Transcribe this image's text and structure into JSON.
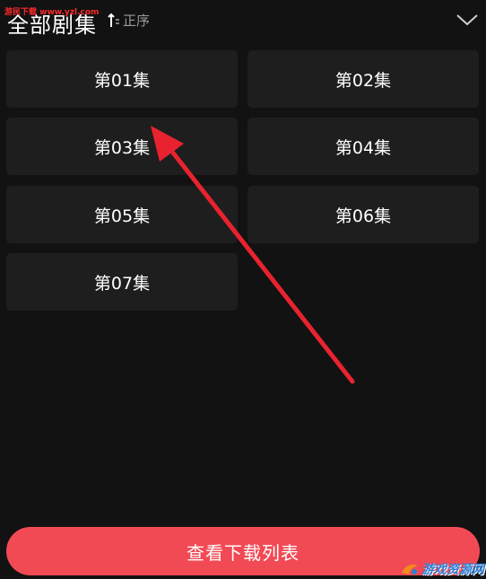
{
  "watermark_top": "游民下载 www.yzl.com",
  "header": {
    "title": "全部剧集",
    "sort_label": "正序"
  },
  "episodes": [
    {
      "label": "第01集"
    },
    {
      "label": "第02集"
    },
    {
      "label": "第03集"
    },
    {
      "label": "第04集"
    },
    {
      "label": "第05集"
    },
    {
      "label": "第06集"
    },
    {
      "label": "第07集"
    }
  ],
  "download_button": {
    "label": "查看下载列表",
    "color": "#f24a55"
  },
  "watermark_bottom": "游戏资源网",
  "colors": {
    "background": "#121212",
    "episode_bg": "#1e1e1e",
    "annotation_arrow": "#e8232f"
  }
}
